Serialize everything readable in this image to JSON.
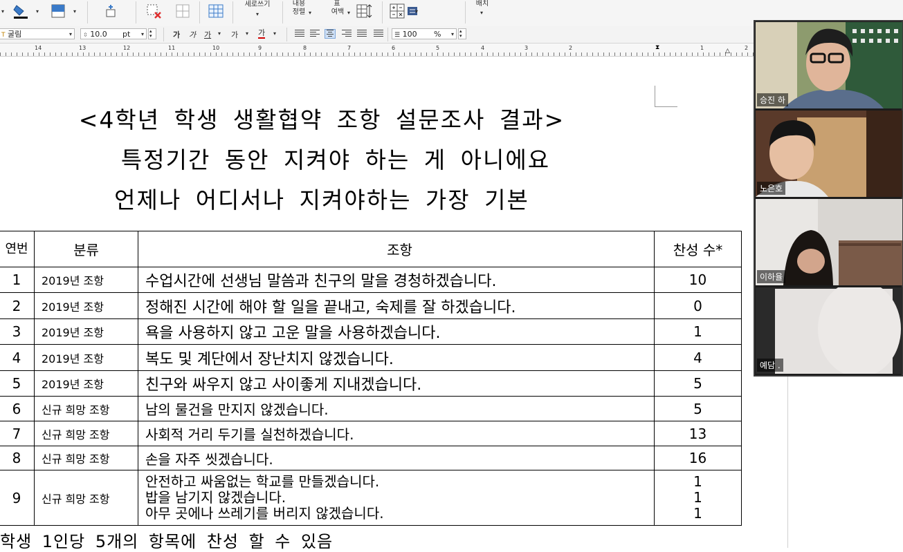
{
  "toolbar": {
    "vertical_writing": "세로쓰기",
    "content_align_line1": "내용",
    "content_align_line2": "정렬",
    "table_margin_line1": "표",
    "table_margin_line2": "여백",
    "arrange": "배치"
  },
  "format_bar": {
    "font_name": "굴림",
    "font_size": "10.0",
    "size_unit": "pt",
    "bold_glyph": "가",
    "italic_glyph": "가",
    "underline_glyph": "가",
    "strike_glyph": "가",
    "color_glyph": "가",
    "line_spacing_value": "100",
    "line_spacing_unit": "%"
  },
  "ruler": {
    "numbers": [
      "14",
      "13",
      "12",
      "11",
      "10",
      "9",
      "8",
      "7",
      "6",
      "5",
      "4",
      "3",
      "2",
      "1",
      "2"
    ]
  },
  "document": {
    "title_line1": "<4학년 학생 생활협약 조항 설문조사 결과>",
    "title_line2": "특정기간 동안 지켜야 하는 게 아니에요",
    "title_line3": "언제나 어디서나 지켜야하는 가장 기본",
    "table": {
      "headers": {
        "no": "연번",
        "category": "분류",
        "item": "조항",
        "count": "찬성 수*"
      },
      "rows": [
        {
          "no": "1",
          "category": "2019년 조항",
          "item": "수업시간에 선생님 말씀과 친구의 말을 경청하겠습니다.",
          "count": "10"
        },
        {
          "no": "2",
          "category": "2019년 조항",
          "item": "정해진 시간에 해야 할 일을 끝내고, 숙제를 잘 하겠습니다.",
          "count": "0"
        },
        {
          "no": "3",
          "category": "2019년 조항",
          "item": "욕을 사용하지 않고 고운 말을 사용하겠습니다.",
          "count": "1"
        },
        {
          "no": "4",
          "category": "2019년 조항",
          "item": "복도 및 계단에서 장난치지 않겠습니다.",
          "count": "4"
        },
        {
          "no": "5",
          "category": "2019년 조항",
          "item": "친구와 싸우지 않고 사이좋게 지내겠습니다.",
          "count": "5"
        },
        {
          "no": "6",
          "category": "신규 희망 조항",
          "item": "남의 물건을 만지지 않겠습니다.",
          "count": "5"
        },
        {
          "no": "7",
          "category": "신규 희망 조항",
          "item": "사회적 거리 두기를 실천하겠습니다.",
          "count": "13"
        },
        {
          "no": "8",
          "category": "신규 희망 조항",
          "item": "손을 자주 씻겠습니다.",
          "count": "16"
        }
      ],
      "row9": {
        "no": "9",
        "category": "신규 희망 조항",
        "items": [
          "안전하고 싸움없는 학교를 만들겠습니다.",
          "밥을 남기지 않겠습니다.",
          "아무 곳에나 쓰레기를 버리지 않겠습니다."
        ],
        "counts": [
          "1",
          "1",
          "1"
        ]
      }
    },
    "footnote": "학생 1인당 5개의 항목에 찬성 할 수 있음"
  },
  "video": {
    "participants": [
      "승진 하",
      "노은호",
      "이하율",
      "예담 ."
    ]
  },
  "colors": {
    "toolbar_bg": "#f5f5f5",
    "video_bg": "#1c1c1c",
    "color_swatch_red": "#d00000",
    "delete_red": "#e03030"
  }
}
